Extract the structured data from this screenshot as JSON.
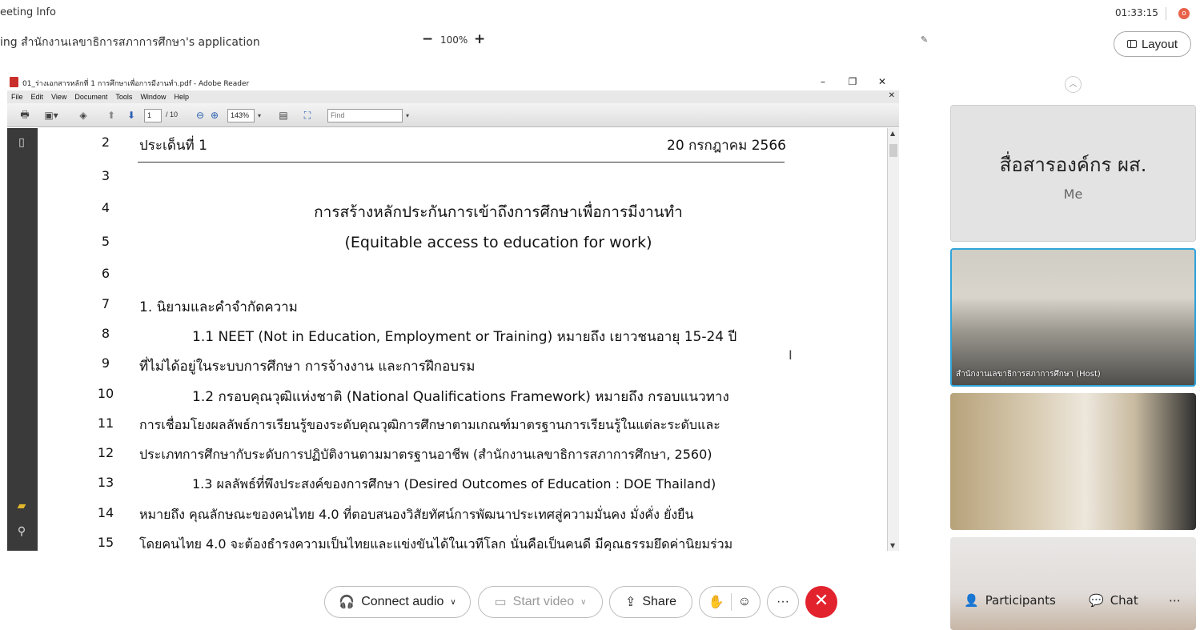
{
  "meeting": {
    "info_label": "eeting Info",
    "timer": "01:33:15",
    "rec_badge": "o",
    "share_title": "ing สำนักงานเลขาธิการสภาการศึกษา's application",
    "zoom_minus": "−",
    "zoom_level": "100%",
    "zoom_plus": "+",
    "layout_label": "Layout"
  },
  "reader": {
    "window_title": "01_ร่างเอกสารหลักที่ 1 การศึกษาเพื่อการมีงานทำ.pdf - Adobe Reader",
    "menu": [
      "File",
      "Edit",
      "View",
      "Document",
      "Tools",
      "Window",
      "Help"
    ],
    "page_current": "1",
    "page_total": "/ 10",
    "zoom": "143%",
    "find_placeholder": "Find"
  },
  "document": {
    "header_left": "ประเด็นที่ 1",
    "header_right": "20 กรกฎาคม 2566",
    "lines": [
      {
        "n": "2"
      },
      {
        "n": "3",
        "text": ""
      },
      {
        "n": "4",
        "text": "การสร้างหลักประกันการเข้าถึงการศึกษาเพื่อการมีงานทำ"
      },
      {
        "n": "5",
        "text": "(Equitable access to education for work)"
      },
      {
        "n": "6",
        "text": ""
      },
      {
        "n": "7",
        "text": "1. นิยามและคำจำกัดความ"
      },
      {
        "n": "8",
        "text": "1.1 NEET (Not in Education, Employment or Training) หมายถึง เยาวชนอายุ 15-24 ปี"
      },
      {
        "n": "9",
        "text": "ที่ไม่ได้อยู่ในระบบการศึกษา การจ้างงาน และการฝึกอบรม"
      },
      {
        "n": "10",
        "text": "1.2 กรอบคุณวุฒิแห่งชาติ (National Qualifications Framework) หมายถึง กรอบแนวทาง"
      },
      {
        "n": "11",
        "text": "การเชื่อมโยงผลลัพธ์การเรียนรู้ของระดับคุณวุฒิการศึกษาตามเกณฑ์มาตรฐานการเรียนรู้ในแต่ละระดับและ"
      },
      {
        "n": "12",
        "text": "ประเภทการศึกษากับระดับการปฏิบัติงานตามมาตรฐานอาชีพ (สำนักงานเลขาธิการสภาการศึกษา, 2560)"
      },
      {
        "n": "13",
        "text": "1.3 ผลลัพธ์ที่พึงประสงค์ของการศึกษา (Desired Outcomes of Education : DOE Thailand)"
      },
      {
        "n": "14",
        "text": "หมายถึง คุณลักษณะของคนไทย 4.0 ที่ตอบสนองวิสัยทัศน์การพัฒนาประเทศสู่ความมั่นคง มั่งคั่ง ยั่งยืน"
      },
      {
        "n": "15",
        "text": "โดยคนไทย 4.0 จะต้องธำรงความเป็นไทยและแข่งขันได้ในเวทีโลก นั่นคือเป็นคนดี มีคุณธรรมยึดค่านิยมร่วม"
      }
    ]
  },
  "participants": {
    "me_name": "สื่อสารองค์กร ผส.",
    "me_label": "Me",
    "host_label": "สำนักงานเลขาธิการสภาการศึกษา (Host)",
    "participants_label": "Participants",
    "chat_label": "Chat"
  },
  "controls": {
    "connect_audio": "Connect audio",
    "start_video": "Start video",
    "share": "Share",
    "more": "···"
  },
  "colors": {
    "hangup": "#e2232e",
    "active_border": "#30a4d8",
    "rec": "#e8624a"
  }
}
